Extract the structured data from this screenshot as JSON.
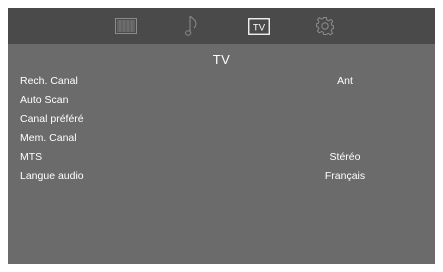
{
  "tabs": [
    {
      "icon": "picture-icon"
    },
    {
      "icon": "music-note-icon"
    },
    {
      "icon": "tv-icon",
      "label": "TV"
    },
    {
      "icon": "gear-icon"
    }
  ],
  "menu": {
    "title": "TV",
    "items": [
      {
        "label": "Rech. Canal",
        "value": "Ant"
      },
      {
        "label": "Auto Scan",
        "value": ""
      },
      {
        "label": "Canal préféré",
        "value": ""
      },
      {
        "label": "Mem. Canal",
        "value": ""
      },
      {
        "label": "MTS",
        "value": "Stéréo"
      },
      {
        "label": "Langue audio",
        "value": "Français"
      }
    ]
  },
  "colors": {
    "panel": "#6b6b6b",
    "topbar": "#4a4a4a",
    "text": "#ffffff",
    "icon_inactive": "#8c8c8c",
    "icon_active": "#ffffff"
  }
}
